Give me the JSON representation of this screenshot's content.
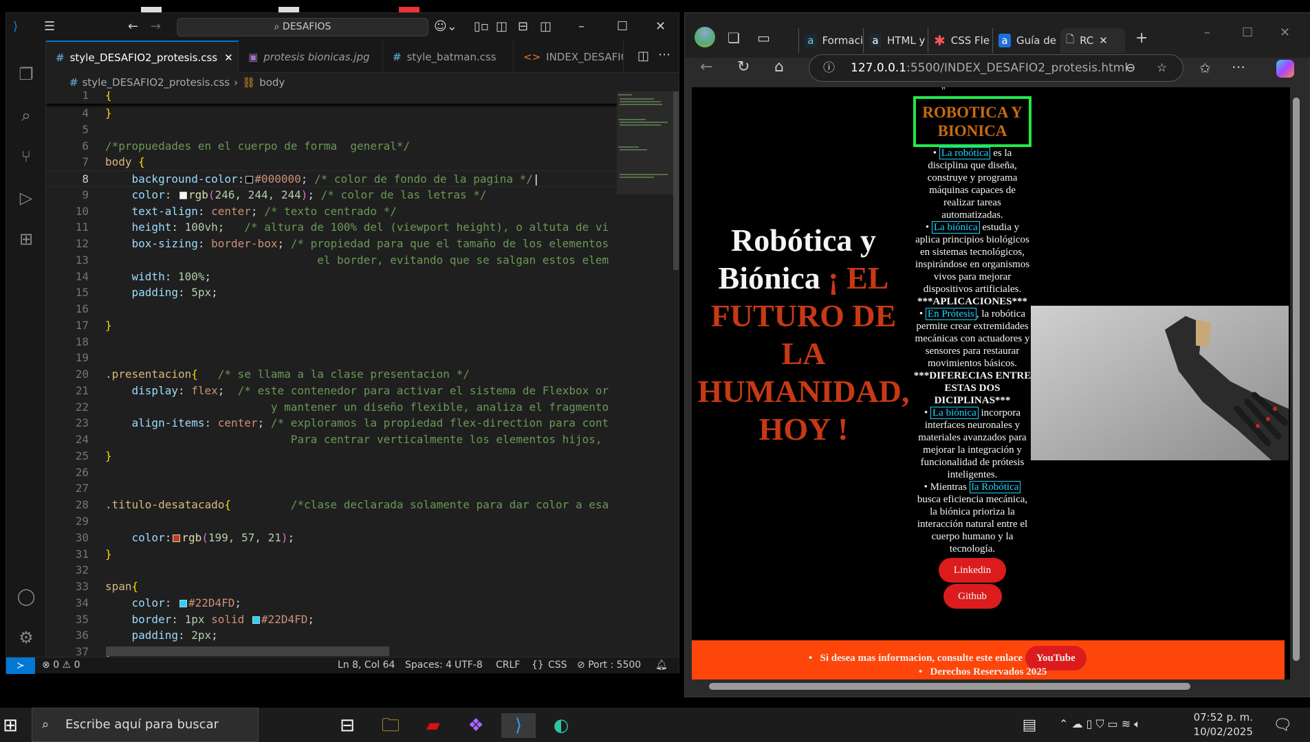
{
  "vscode": {
    "search": "DESAFIOS",
    "tabs": [
      {
        "label": "style_DESAFIO2_protesis.css",
        "icon": "css-hash-icon",
        "active": true
      },
      {
        "label": "protesis bionicas.jpg",
        "icon": "image-icon"
      },
      {
        "label": "style_batman.css",
        "icon": "css-hash-icon"
      },
      {
        "label": "INDEX_DESAFIC",
        "icon": "html-icon"
      }
    ],
    "breadcrumb": {
      "file": "style_DESAFIO2_protesis.css",
      "symbol": "body"
    },
    "code": [
      {
        "n": "1",
        "t": [
          [
            "brace",
            "{"
          ]
        ],
        "sticky": true
      },
      {
        "n": "4",
        "t": [
          [
            "brace",
            "}"
          ]
        ]
      },
      {
        "n": "5",
        "t": []
      },
      {
        "n": "6",
        "t": [
          [
            "com",
            "/*propuedades en el cuerpo de forma  general*/"
          ]
        ]
      },
      {
        "n": "7",
        "t": [
          [
            "sel",
            "body "
          ],
          [
            "brace",
            "{"
          ]
        ]
      },
      {
        "n": "8",
        "t": [
          [
            "p",
            "    "
          ],
          [
            "prop",
            "background-color"
          ],
          [
            "p",
            ":"
          ],
          [
            "sw",
            "#000000"
          ],
          [
            "val",
            "#000000"
          ],
          [
            "p",
            "; "
          ],
          [
            "com",
            "/* color de fondo de la pagina */"
          ]
        ],
        "current": true
      },
      {
        "n": "9",
        "t": [
          [
            "p",
            "    "
          ],
          [
            "prop",
            "color"
          ],
          [
            "p",
            ": "
          ],
          [
            "sw",
            "#F6F4F4"
          ],
          [
            "fn",
            "rgb"
          ],
          [
            "paren",
            "("
          ],
          [
            "num",
            "246, 244, 244"
          ],
          [
            "paren",
            ")"
          ],
          [
            "p",
            "; "
          ],
          [
            "com",
            "/* color de las letras */"
          ]
        ]
      },
      {
        "n": "10",
        "t": [
          [
            "p",
            "    "
          ],
          [
            "prop",
            "text-align"
          ],
          [
            "p",
            ": "
          ],
          [
            "val",
            "center"
          ],
          [
            "p",
            "; "
          ],
          [
            "com",
            "/* texto centrado */"
          ]
        ]
      },
      {
        "n": "11",
        "t": [
          [
            "p",
            "    "
          ],
          [
            "prop",
            "height"
          ],
          [
            "p",
            ": "
          ],
          [
            "num",
            "100vh"
          ],
          [
            "p",
            ";   "
          ],
          [
            "com",
            "/* altura de 100% del (viewport height), o altuta de vi"
          ]
        ]
      },
      {
        "n": "12",
        "t": [
          [
            "p",
            "    "
          ],
          [
            "prop",
            "box-sizing"
          ],
          [
            "p",
            ": "
          ],
          [
            "val",
            "border-box"
          ],
          [
            "p",
            "; "
          ],
          [
            "com",
            "/* propiedad para que el tamaño de los elementos"
          ]
        ]
      },
      {
        "n": "13",
        "t": [
          [
            "p",
            "                                "
          ],
          [
            "com",
            "el border, evitando que se salgan estos elem"
          ]
        ]
      },
      {
        "n": "14",
        "t": [
          [
            "p",
            "    "
          ],
          [
            "prop",
            "width"
          ],
          [
            "p",
            ": "
          ],
          [
            "num",
            "100%"
          ],
          [
            "p",
            ";"
          ]
        ]
      },
      {
        "n": "15",
        "t": [
          [
            "p",
            "    "
          ],
          [
            "prop",
            "padding"
          ],
          [
            "p",
            ": "
          ],
          [
            "num",
            "5px"
          ],
          [
            "p",
            ";"
          ]
        ]
      },
      {
        "n": "16",
        "t": []
      },
      {
        "n": "17",
        "t": [
          [
            "brace",
            "}"
          ]
        ]
      },
      {
        "n": "18",
        "t": []
      },
      {
        "n": "19",
        "t": []
      },
      {
        "n": "20",
        "t": [
          [
            "sel",
            ".presentacion"
          ],
          [
            "brace",
            "{"
          ],
          [
            "p",
            "   "
          ],
          [
            "com",
            "/* se llama a la clase presentacion */"
          ]
        ]
      },
      {
        "n": "21",
        "t": [
          [
            "p",
            "    "
          ],
          [
            "prop",
            "display"
          ],
          [
            "p",
            ": "
          ],
          [
            "val",
            "flex"
          ],
          [
            "p",
            ";  "
          ],
          [
            "com",
            "/* este contenedor para activar el sistema de Flexbox or"
          ]
        ]
      },
      {
        "n": "22",
        "t": [
          [
            "p",
            "                         "
          ],
          [
            "com",
            "y mantener un diseño flexible, analiza el fragmento"
          ]
        ]
      },
      {
        "n": "23",
        "t": [
          [
            "p",
            "    "
          ],
          [
            "prop",
            "align-items"
          ],
          [
            "p",
            ": "
          ],
          [
            "val",
            "center"
          ],
          [
            "p",
            "; "
          ],
          [
            "com",
            "/* exploramos la propiedad flex-direction para cont"
          ]
        ]
      },
      {
        "n": "24",
        "t": [
          [
            "p",
            "                            "
          ],
          [
            "com",
            "Para centrar verticalmente los elementos hijos,"
          ]
        ]
      },
      {
        "n": "25",
        "t": [
          [
            "brace",
            "}"
          ]
        ]
      },
      {
        "n": "26",
        "t": []
      },
      {
        "n": "27",
        "t": []
      },
      {
        "n": "28",
        "t": [
          [
            "sel",
            ".titulo-desatacado"
          ],
          [
            "brace",
            "{"
          ],
          [
            "p",
            "         "
          ],
          [
            "com",
            "/*clase declarada solamente para dar color a esa"
          ]
        ]
      },
      {
        "n": "29",
        "t": []
      },
      {
        "n": "30",
        "t": [
          [
            "p",
            "    "
          ],
          [
            "prop",
            "color"
          ],
          [
            "p",
            ":"
          ],
          [
            "sw",
            "#C73915"
          ],
          [
            "fn",
            "rgb"
          ],
          [
            "paren",
            "("
          ],
          [
            "num",
            "199, 57, 21"
          ],
          [
            "paren",
            ")"
          ],
          [
            "p",
            ";"
          ]
        ]
      },
      {
        "n": "31",
        "t": [
          [
            "brace",
            "}"
          ]
        ]
      },
      {
        "n": "32",
        "t": []
      },
      {
        "n": "33",
        "t": [
          [
            "sel",
            "span"
          ],
          [
            "brace",
            "{"
          ]
        ]
      },
      {
        "n": "34",
        "t": [
          [
            "p",
            "    "
          ],
          [
            "prop",
            "color"
          ],
          [
            "p",
            ": "
          ],
          [
            "sw",
            "#22D4FD"
          ],
          [
            "val",
            "#22D4FD"
          ],
          [
            "p",
            ";"
          ]
        ]
      },
      {
        "n": "35",
        "t": [
          [
            "p",
            "    "
          ],
          [
            "prop",
            "border"
          ],
          [
            "p",
            ": "
          ],
          [
            "num",
            "1px "
          ],
          [
            "val",
            "solid "
          ],
          [
            "sw",
            "#22D4FD"
          ],
          [
            "val",
            "#22D4FD"
          ],
          [
            "p",
            ";"
          ]
        ]
      },
      {
        "n": "36",
        "t": [
          [
            "p",
            "    "
          ],
          [
            "prop",
            "padding"
          ],
          [
            "p",
            ": "
          ],
          [
            "num",
            "2px"
          ],
          [
            "p",
            ";"
          ]
        ]
      },
      {
        "n": "37",
        "t": [
          [
            "brace",
            "}"
          ]
        ]
      }
    ],
    "status": {
      "errors": "0",
      "warnings": "0",
      "position": "Ln 8, Col 64",
      "spaces": "Spaces: 4",
      "encoding": "UTF-8",
      "eol": "CRLF",
      "language": "CSS",
      "port": "Port : 5500"
    }
  },
  "browser": {
    "tabs": [
      {
        "label": "Formaci"
      },
      {
        "label": "HTML y"
      },
      {
        "label": "CSS Fle"
      },
      {
        "label": "Guía de"
      },
      {
        "label": "RC",
        "active": true
      }
    ],
    "url_host": "127.0.0.1",
    "url_rest": ":5500/INDEX_DESAFIO2_protesis.html",
    "page": {
      "quote_mark": "\"",
      "title_white": "Robótica y Biónica",
      "title_red": "¡ EL FUTURO DE LA HUMANIDAD, HOY !",
      "box_title": "ROBOTICA Y BIONICA",
      "p1_link": "La robótica",
      "p1_text": "es la disciplina que diseña, construye y programa máquinas capaces de realizar tareas automatizadas.",
      "p2_link": "La biónica",
      "p2_text": "estudia y aplica principios biológicos en sistemas tecnológicos, inspirándose en organismos vivos para mejorar dispositivos artificiales.",
      "aplicaciones": "***APLICACIONES***",
      "p3_link": "En Prótesis",
      "p3_text": ", la robótica permite crear extremidades mecánicas con actuadores y sensores para restaurar movimientos básicos.",
      "diferencias": "***DIFERECIAS ENTRE ESTAS DOS DICIPLINAS***",
      "p4_link": "La biónica",
      "p4_text": "incorpora interfaces neuronales y materiales avanzados para mejorar la integración y funcionalidad de prótesis inteligentes.",
      "p5_pre": "Mientras",
      "p5_link": "la Robótica",
      "p5_text": "busca eficiencia mecánica, la biónica prioriza la interacción natural entre el cuerpo humano y la tecnología.",
      "btn_linkedin": "Linkedin",
      "btn_github": "Github",
      "footer_info": "Si desea mas informacion, consulte este enlace",
      "btn_youtube": "YouTube",
      "footer_rights": "Derechos Reservados 2025"
    },
    "colors": {
      "title_red": "#C73915",
      "box_border": "#22E84A",
      "box_text": "#C86A12",
      "span_cyan": "#22D4FD",
      "footer": "#FF460A",
      "button": "#DC1C1C"
    }
  },
  "taskbar": {
    "search_placeholder": "Escribe aquí para buscar",
    "time": "07:52 p. m.",
    "date": "10/02/2025"
  }
}
